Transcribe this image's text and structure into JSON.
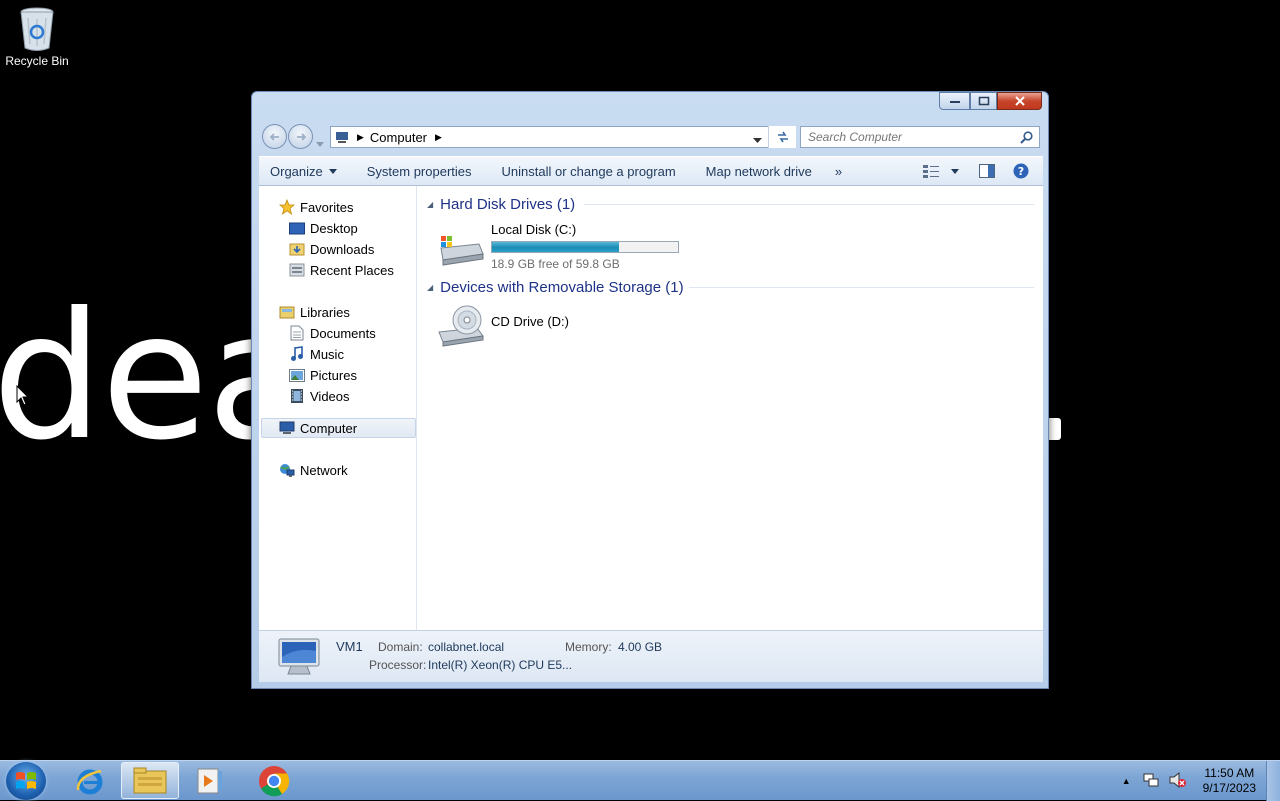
{
  "desktop": {
    "wallpaper_text": "deat",
    "icons": [
      {
        "label": "Recycle Bin",
        "icon": "recycle-bin-icon"
      }
    ]
  },
  "window": {
    "address": {
      "location": "Computer"
    },
    "search": {
      "placeholder": "Search Computer"
    },
    "toolbar": {
      "organize": "Organize",
      "system_properties": "System properties",
      "uninstall": "Uninstall or change a program",
      "map_drive": "Map network drive",
      "more": "»"
    },
    "nav": {
      "favorites": {
        "label": "Favorites",
        "items": [
          "Desktop",
          "Downloads",
          "Recent Places"
        ]
      },
      "libraries": {
        "label": "Libraries",
        "items": [
          "Documents",
          "Music",
          "Pictures",
          "Videos"
        ]
      },
      "computer": "Computer",
      "network": "Network"
    },
    "groups": {
      "hdd": {
        "title": "Hard Disk Drives (1)",
        "drives": [
          {
            "name": "Local Disk (C:)",
            "free": "18.9 GB free of 59.8 GB",
            "used_fraction": 0.684
          }
        ]
      },
      "removable": {
        "title": "Devices with Removable Storage (1)",
        "drives": [
          {
            "name": "CD Drive (D:)"
          }
        ]
      }
    },
    "details": {
      "name": "VM1",
      "domain_label": "Domain:",
      "domain_value": "collabnet.local",
      "memory_label": "Memory:",
      "memory_value": "4.00 GB",
      "processor_label": "Processor:",
      "processor_value": "Intel(R) Xeon(R) CPU E5..."
    }
  },
  "taskbar": {
    "apps": [
      "internet-explorer-icon",
      "windows-explorer-icon",
      "media-player-icon",
      "chrome-icon"
    ],
    "clock": {
      "time": "11:50 AM",
      "date": "9/17/2023"
    }
  },
  "colors": {
    "accent": "#1e3287",
    "progress": "#1a8cb5",
    "taskbar": "#7ea6d5"
  }
}
